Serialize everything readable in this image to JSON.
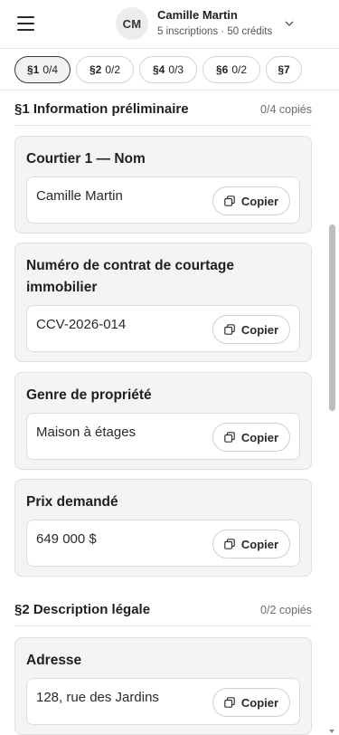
{
  "header": {
    "avatar_initials": "CM",
    "account_name": "Camille Martin",
    "account_sub": "5 inscriptions · 50 crédits"
  },
  "tabs": [
    {
      "sec": "§1",
      "count": "0/4",
      "active": true
    },
    {
      "sec": "§2",
      "count": "0/2",
      "active": false
    },
    {
      "sec": "§4",
      "count": "0/3",
      "active": false
    },
    {
      "sec": "§6",
      "count": "0/2",
      "active": false
    },
    {
      "sec": "§7",
      "count": "",
      "active": false
    }
  ],
  "sections": [
    {
      "title": "§1 Information préliminaire",
      "count": "0/4 copiés",
      "fields": [
        {
          "label": "Courtier 1 — Nom",
          "value": "Camille Martin"
        },
        {
          "label": "Numéro de contrat de courtage immobilier",
          "value": "CCV-2026-014"
        },
        {
          "label": "Genre de propriété",
          "value": "Maison à étages"
        },
        {
          "label": "Prix demandé",
          "value": "649 000 $"
        }
      ]
    },
    {
      "title": "§2 Description légale",
      "count": "0/2 copiés",
      "fields": [
        {
          "label": "Adresse",
          "value": "128, rue des Jardins"
        }
      ]
    }
  ],
  "copy_label": "Copier",
  "icons": {
    "menu": "hamburger-menu-icon",
    "account_chevron": "chevron-down-icon",
    "copy": "copy-icon"
  }
}
